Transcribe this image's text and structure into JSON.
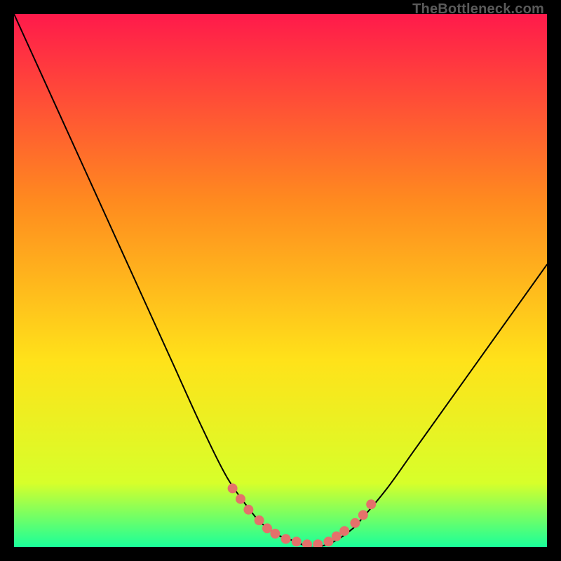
{
  "watermark": "TheBottleneck.com",
  "colors": {
    "bg": "#000000",
    "gradient_top": "#ff1a4b",
    "gradient_mid1": "#ff8a1f",
    "gradient_mid2": "#ffe21a",
    "gradient_bottom_lime": "#d7ff2a",
    "gradient_bottom_green": "#1aff9a",
    "curve_stroke": "#000000",
    "marker_fill": "#e4716b"
  },
  "chart_data": {
    "type": "line",
    "title": "",
    "xlabel": "",
    "ylabel": "",
    "xlim": [
      0,
      100
    ],
    "ylim": [
      0,
      100
    ],
    "series": [
      {
        "name": "bottleneck-curve",
        "x": [
          0,
          5,
          10,
          15,
          20,
          25,
          30,
          35,
          40,
          45,
          47,
          50,
          53,
          55,
          57,
          60,
          63,
          65,
          70,
          75,
          80,
          85,
          90,
          95,
          100
        ],
        "values": [
          100,
          89,
          78,
          67,
          56,
          45,
          34,
          23,
          13,
          6,
          4,
          2,
          1,
          0,
          0,
          1,
          3,
          5,
          11,
          18,
          25,
          32,
          39,
          46,
          53
        ]
      }
    ],
    "markers": {
      "name": "highlight-dots",
      "x": [
        41,
        42.5,
        44,
        46,
        47.5,
        49,
        51,
        53,
        55,
        57,
        59,
        60.5,
        62,
        64,
        65.5,
        67
      ],
      "values": [
        11,
        9,
        7,
        5,
        3.5,
        2.5,
        1.5,
        1,
        0.5,
        0.5,
        1,
        2,
        3,
        4.5,
        6,
        8
      ]
    }
  }
}
